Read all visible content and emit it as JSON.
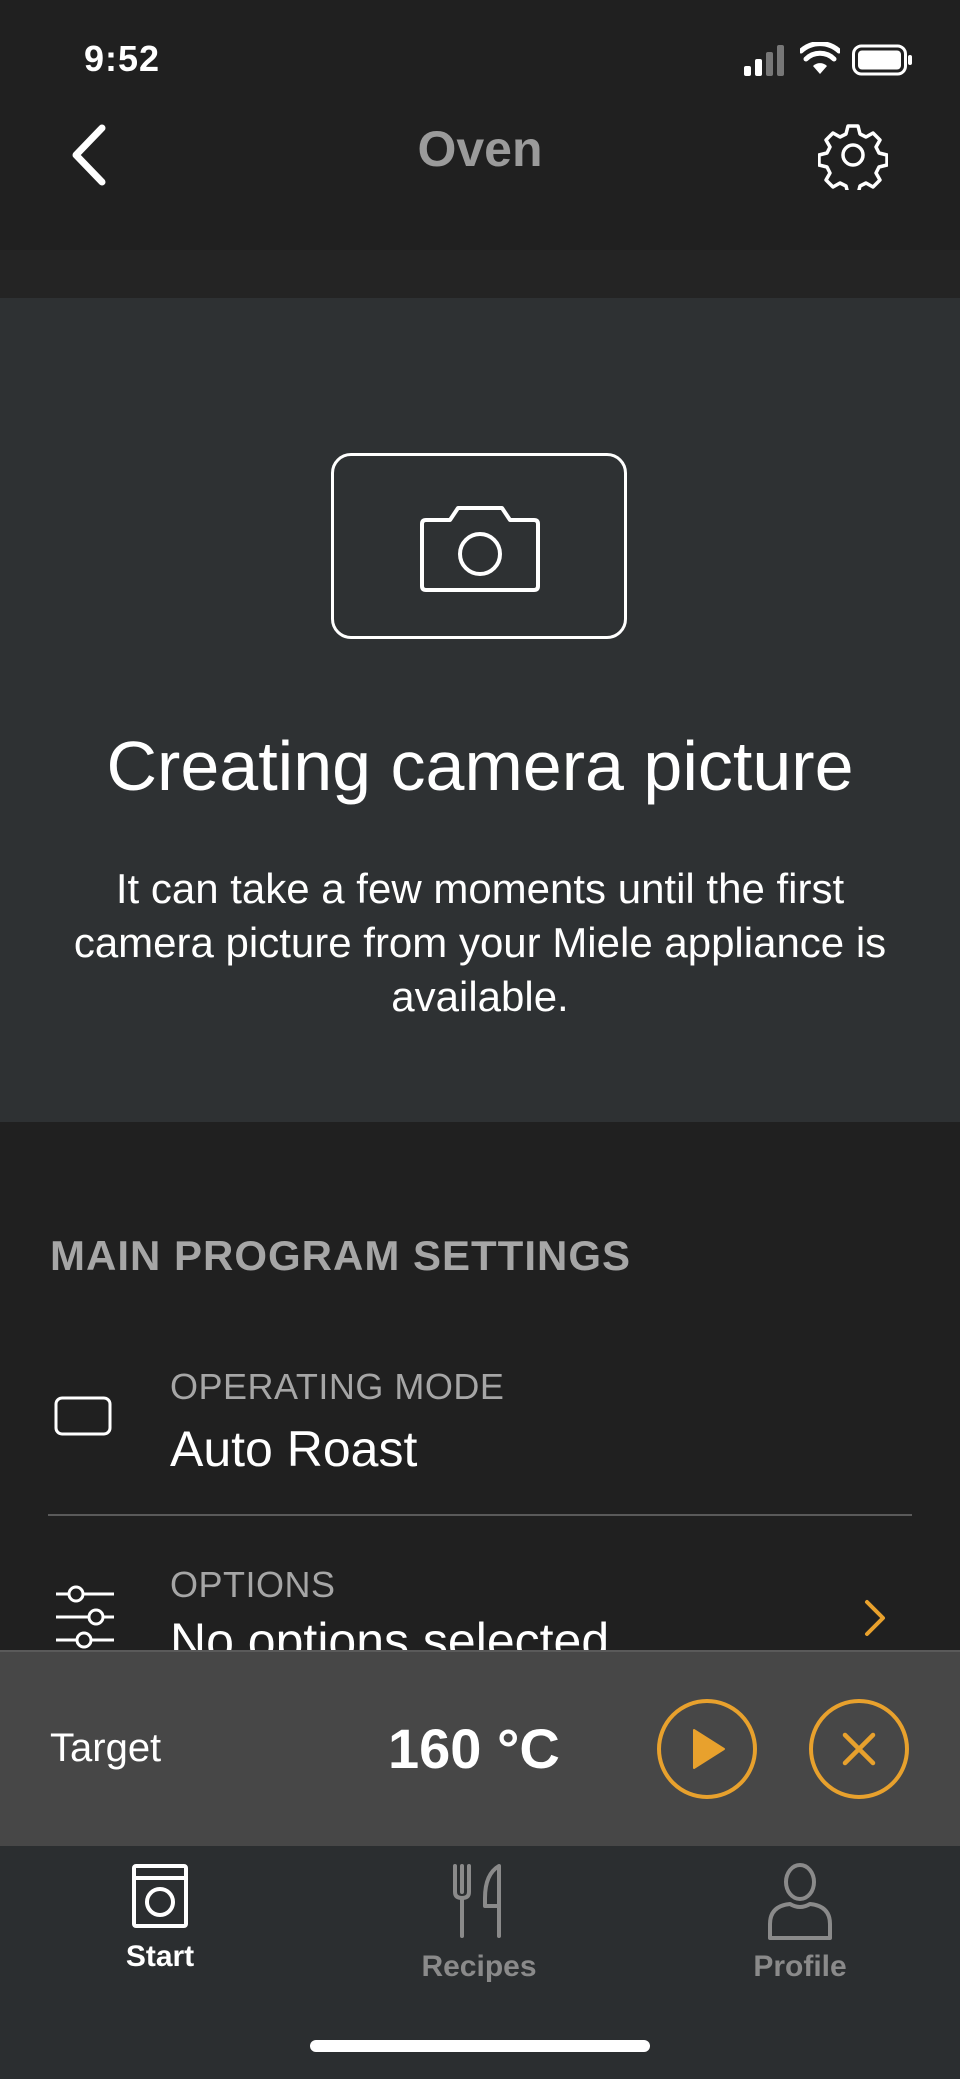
{
  "status": {
    "time": "9:52"
  },
  "nav": {
    "title": "Oven"
  },
  "camera": {
    "title": "Creating camera picture",
    "message": "It can take a few moments until the first camera picture from your Miele appliance is available."
  },
  "settings": {
    "section_title": "MAIN PROGRAM SETTINGS",
    "operating_mode": {
      "label": "OPERATING MODE",
      "value": "Auto Roast"
    },
    "options": {
      "label": "OPTIONS",
      "value": "No options selected"
    }
  },
  "target": {
    "label": "Target",
    "value": "160 °C"
  },
  "colors": {
    "accent": "#e8a12d",
    "panel": "#2e3133",
    "background": "#202020"
  },
  "tabs": [
    {
      "label": "Start",
      "icon": "oven-icon",
      "active": true
    },
    {
      "label": "Recipes",
      "icon": "fork-knife-icon",
      "active": false
    },
    {
      "label": "Profile",
      "icon": "person-icon",
      "active": false
    }
  ]
}
